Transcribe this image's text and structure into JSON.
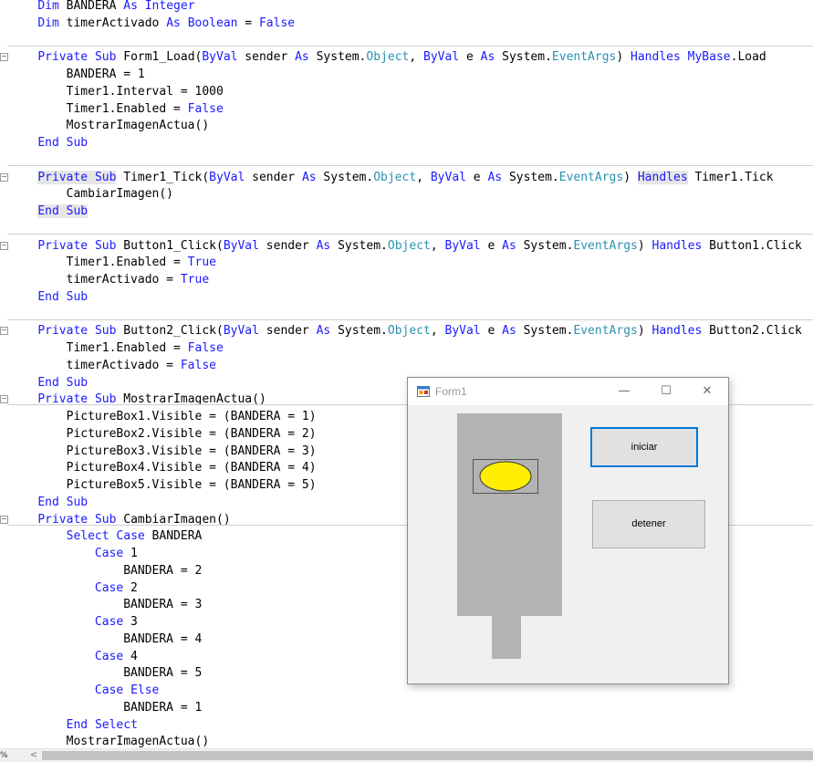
{
  "editor": {
    "lines": [
      [
        {
          "t": "    "
        },
        {
          "t": "Dim",
          "c": "kw"
        },
        {
          "t": " BANDERA "
        },
        {
          "t": "As",
          "c": "kw"
        },
        {
          "t": " "
        },
        {
          "t": "Integer",
          "c": "kw"
        }
      ],
      [
        {
          "t": "    "
        },
        {
          "t": "Dim",
          "c": "kw"
        },
        {
          "t": " timerActivado "
        },
        {
          "t": "As",
          "c": "kw"
        },
        {
          "t": " "
        },
        {
          "t": "Boolean",
          "c": "kw"
        },
        {
          "t": " = "
        },
        {
          "t": "False",
          "c": "kw"
        }
      ],
      [],
      [
        {
          "t": "    "
        },
        {
          "t": "Private",
          "c": "kw"
        },
        {
          "t": " "
        },
        {
          "t": "Sub",
          "c": "kw"
        },
        {
          "t": " Form1_Load("
        },
        {
          "t": "ByVal",
          "c": "kw"
        },
        {
          "t": " sender "
        },
        {
          "t": "As",
          "c": "kw"
        },
        {
          "t": " System."
        },
        {
          "t": "Object",
          "c": "ty"
        },
        {
          "t": ", "
        },
        {
          "t": "ByVal",
          "c": "kw"
        },
        {
          "t": " e "
        },
        {
          "t": "As",
          "c": "kw"
        },
        {
          "t": " System."
        },
        {
          "t": "EventArgs",
          "c": "ty"
        },
        {
          "t": ") "
        },
        {
          "t": "Handles",
          "c": "kw"
        },
        {
          "t": " "
        },
        {
          "t": "MyBase",
          "c": "kw"
        },
        {
          "t": ".Load"
        }
      ],
      [
        {
          "t": "        BANDERA = 1"
        }
      ],
      [
        {
          "t": "        Timer1.Interval = 1000"
        }
      ],
      [
        {
          "t": "        Timer1.Enabled = "
        },
        {
          "t": "False",
          "c": "kw"
        }
      ],
      [
        {
          "t": "        MostrarImagenActua()"
        }
      ],
      [
        {
          "t": "    "
        },
        {
          "t": "End",
          "c": "kw"
        },
        {
          "t": " "
        },
        {
          "t": "Sub",
          "c": "kw"
        }
      ],
      [],
      [
        {
          "t": "    "
        },
        {
          "t": "Private",
          "c": "kw hl"
        },
        {
          "t": " ",
          "c": "hl"
        },
        {
          "t": "Sub",
          "c": "kw hl"
        },
        {
          "t": " Timer1_Tick("
        },
        {
          "t": "ByVal",
          "c": "kw"
        },
        {
          "t": " sender "
        },
        {
          "t": "As",
          "c": "kw"
        },
        {
          "t": " System."
        },
        {
          "t": "Object",
          "c": "ty"
        },
        {
          "t": ", "
        },
        {
          "t": "ByVal",
          "c": "kw"
        },
        {
          "t": " e "
        },
        {
          "t": "As",
          "c": "kw"
        },
        {
          "t": " System."
        },
        {
          "t": "EventArgs",
          "c": "ty"
        },
        {
          "t": ") "
        },
        {
          "t": "Handles",
          "c": "kw hl"
        },
        {
          "t": " Timer1.Tick"
        }
      ],
      [
        {
          "t": "        CambiarImagen()"
        }
      ],
      [
        {
          "t": "    "
        },
        {
          "t": "End",
          "c": "kw hl"
        },
        {
          "t": " ",
          "c": "hl"
        },
        {
          "t": "Sub",
          "c": "kw hl"
        }
      ],
      [],
      [
        {
          "t": "    "
        },
        {
          "t": "Private",
          "c": "kw"
        },
        {
          "t": " "
        },
        {
          "t": "Sub",
          "c": "kw"
        },
        {
          "t": " Button1_Click("
        },
        {
          "t": "ByVal",
          "c": "kw"
        },
        {
          "t": " sender "
        },
        {
          "t": "As",
          "c": "kw"
        },
        {
          "t": " System."
        },
        {
          "t": "Object",
          "c": "ty"
        },
        {
          "t": ", "
        },
        {
          "t": "ByVal",
          "c": "kw"
        },
        {
          "t": " e "
        },
        {
          "t": "As",
          "c": "kw"
        },
        {
          "t": " System."
        },
        {
          "t": "EventArgs",
          "c": "ty"
        },
        {
          "t": ") "
        },
        {
          "t": "Handles",
          "c": "kw"
        },
        {
          "t": " Button1.Click"
        }
      ],
      [
        {
          "t": "        Timer1.Enabled = "
        },
        {
          "t": "True",
          "c": "kw"
        }
      ],
      [
        {
          "t": "        timerActivado = "
        },
        {
          "t": "True",
          "c": "kw"
        }
      ],
      [
        {
          "t": "    "
        },
        {
          "t": "End",
          "c": "kw"
        },
        {
          "t": " "
        },
        {
          "t": "Sub",
          "c": "kw"
        }
      ],
      [],
      [
        {
          "t": "    "
        },
        {
          "t": "Private",
          "c": "kw"
        },
        {
          "t": " "
        },
        {
          "t": "Sub",
          "c": "kw"
        },
        {
          "t": " Button2_Click("
        },
        {
          "t": "ByVal",
          "c": "kw"
        },
        {
          "t": " sender "
        },
        {
          "t": "As",
          "c": "kw"
        },
        {
          "t": " System."
        },
        {
          "t": "Object",
          "c": "ty"
        },
        {
          "t": ", "
        },
        {
          "t": "ByVal",
          "c": "kw"
        },
        {
          "t": " e "
        },
        {
          "t": "As",
          "c": "kw"
        },
        {
          "t": " System."
        },
        {
          "t": "EventArgs",
          "c": "ty"
        },
        {
          "t": ") "
        },
        {
          "t": "Handles",
          "c": "kw"
        },
        {
          "t": " Button2.Click"
        }
      ],
      [
        {
          "t": "        Timer1.Enabled = "
        },
        {
          "t": "False",
          "c": "kw"
        }
      ],
      [
        {
          "t": "        timerActivado = "
        },
        {
          "t": "False",
          "c": "kw"
        }
      ],
      [
        {
          "t": "    "
        },
        {
          "t": "End",
          "c": "kw"
        },
        {
          "t": " "
        },
        {
          "t": "Sub",
          "c": "kw"
        }
      ],
      [
        {
          "t": "    "
        },
        {
          "t": "Private",
          "c": "kw"
        },
        {
          "t": " "
        },
        {
          "t": "Sub",
          "c": "kw"
        },
        {
          "t": " MostrarImagenActua()"
        }
      ],
      [
        {
          "t": "        PictureBox1.Visible = (BANDERA = 1)"
        }
      ],
      [
        {
          "t": "        PictureBox2.Visible = (BANDERA = 2)"
        }
      ],
      [
        {
          "t": "        PictureBox3.Visible = (BANDERA = 3)"
        }
      ],
      [
        {
          "t": "        PictureBox4.Visible = (BANDERA = 4)"
        }
      ],
      [
        {
          "t": "        PictureBox5.Visible = (BANDERA = 5)"
        }
      ],
      [
        {
          "t": "    "
        },
        {
          "t": "End",
          "c": "kw"
        },
        {
          "t": " "
        },
        {
          "t": "Sub",
          "c": "kw"
        }
      ],
      [
        {
          "t": "    "
        },
        {
          "t": "Private",
          "c": "kw"
        },
        {
          "t": " "
        },
        {
          "t": "Sub",
          "c": "kw"
        },
        {
          "t": " CambiarImagen()"
        }
      ],
      [
        {
          "t": "        "
        },
        {
          "t": "Select",
          "c": "kw"
        },
        {
          "t": " "
        },
        {
          "t": "Case",
          "c": "kw"
        },
        {
          "t": " BANDERA"
        }
      ],
      [
        {
          "t": "            "
        },
        {
          "t": "Case",
          "c": "kw"
        },
        {
          "t": " 1"
        }
      ],
      [
        {
          "t": "                BANDERA = 2"
        }
      ],
      [
        {
          "t": "            "
        },
        {
          "t": "Case",
          "c": "kw"
        },
        {
          "t": " 2"
        }
      ],
      [
        {
          "t": "                BANDERA = 3"
        }
      ],
      [
        {
          "t": "            "
        },
        {
          "t": "Case",
          "c": "kw"
        },
        {
          "t": " 3"
        }
      ],
      [
        {
          "t": "                BANDERA = 4"
        }
      ],
      [
        {
          "t": "            "
        },
        {
          "t": "Case",
          "c": "kw"
        },
        {
          "t": " 4"
        }
      ],
      [
        {
          "t": "                BANDERA = 5"
        }
      ],
      [
        {
          "t": "            "
        },
        {
          "t": "Case",
          "c": "kw"
        },
        {
          "t": " "
        },
        {
          "t": "Else",
          "c": "kw"
        }
      ],
      [
        {
          "t": "                BANDERA = 1"
        }
      ],
      [
        {
          "t": "        "
        },
        {
          "t": "End",
          "c": "kw"
        },
        {
          "t": " "
        },
        {
          "t": "Select",
          "c": "kw"
        }
      ],
      [
        {
          "t": "        MostrarImagenActua()"
        }
      ]
    ],
    "fold_glyph": "−"
  },
  "status_bar": {
    "zoom_label": "%",
    "scroll_left_glyph": "<"
  },
  "form": {
    "title": "Form1",
    "icon": "form-app-icon",
    "minimize_glyph": "—",
    "maximize_glyph": "☐",
    "close_glyph": "✕",
    "iniciar_label": "iniciar",
    "detener_label": "detener",
    "picture_color": "#ffee00",
    "panel_color": "#b3b3b3",
    "accent_color": "#0078d7"
  },
  "colors": {
    "keyword": "#1a1aff",
    "type": "#2b91af",
    "text": "#000000"
  }
}
